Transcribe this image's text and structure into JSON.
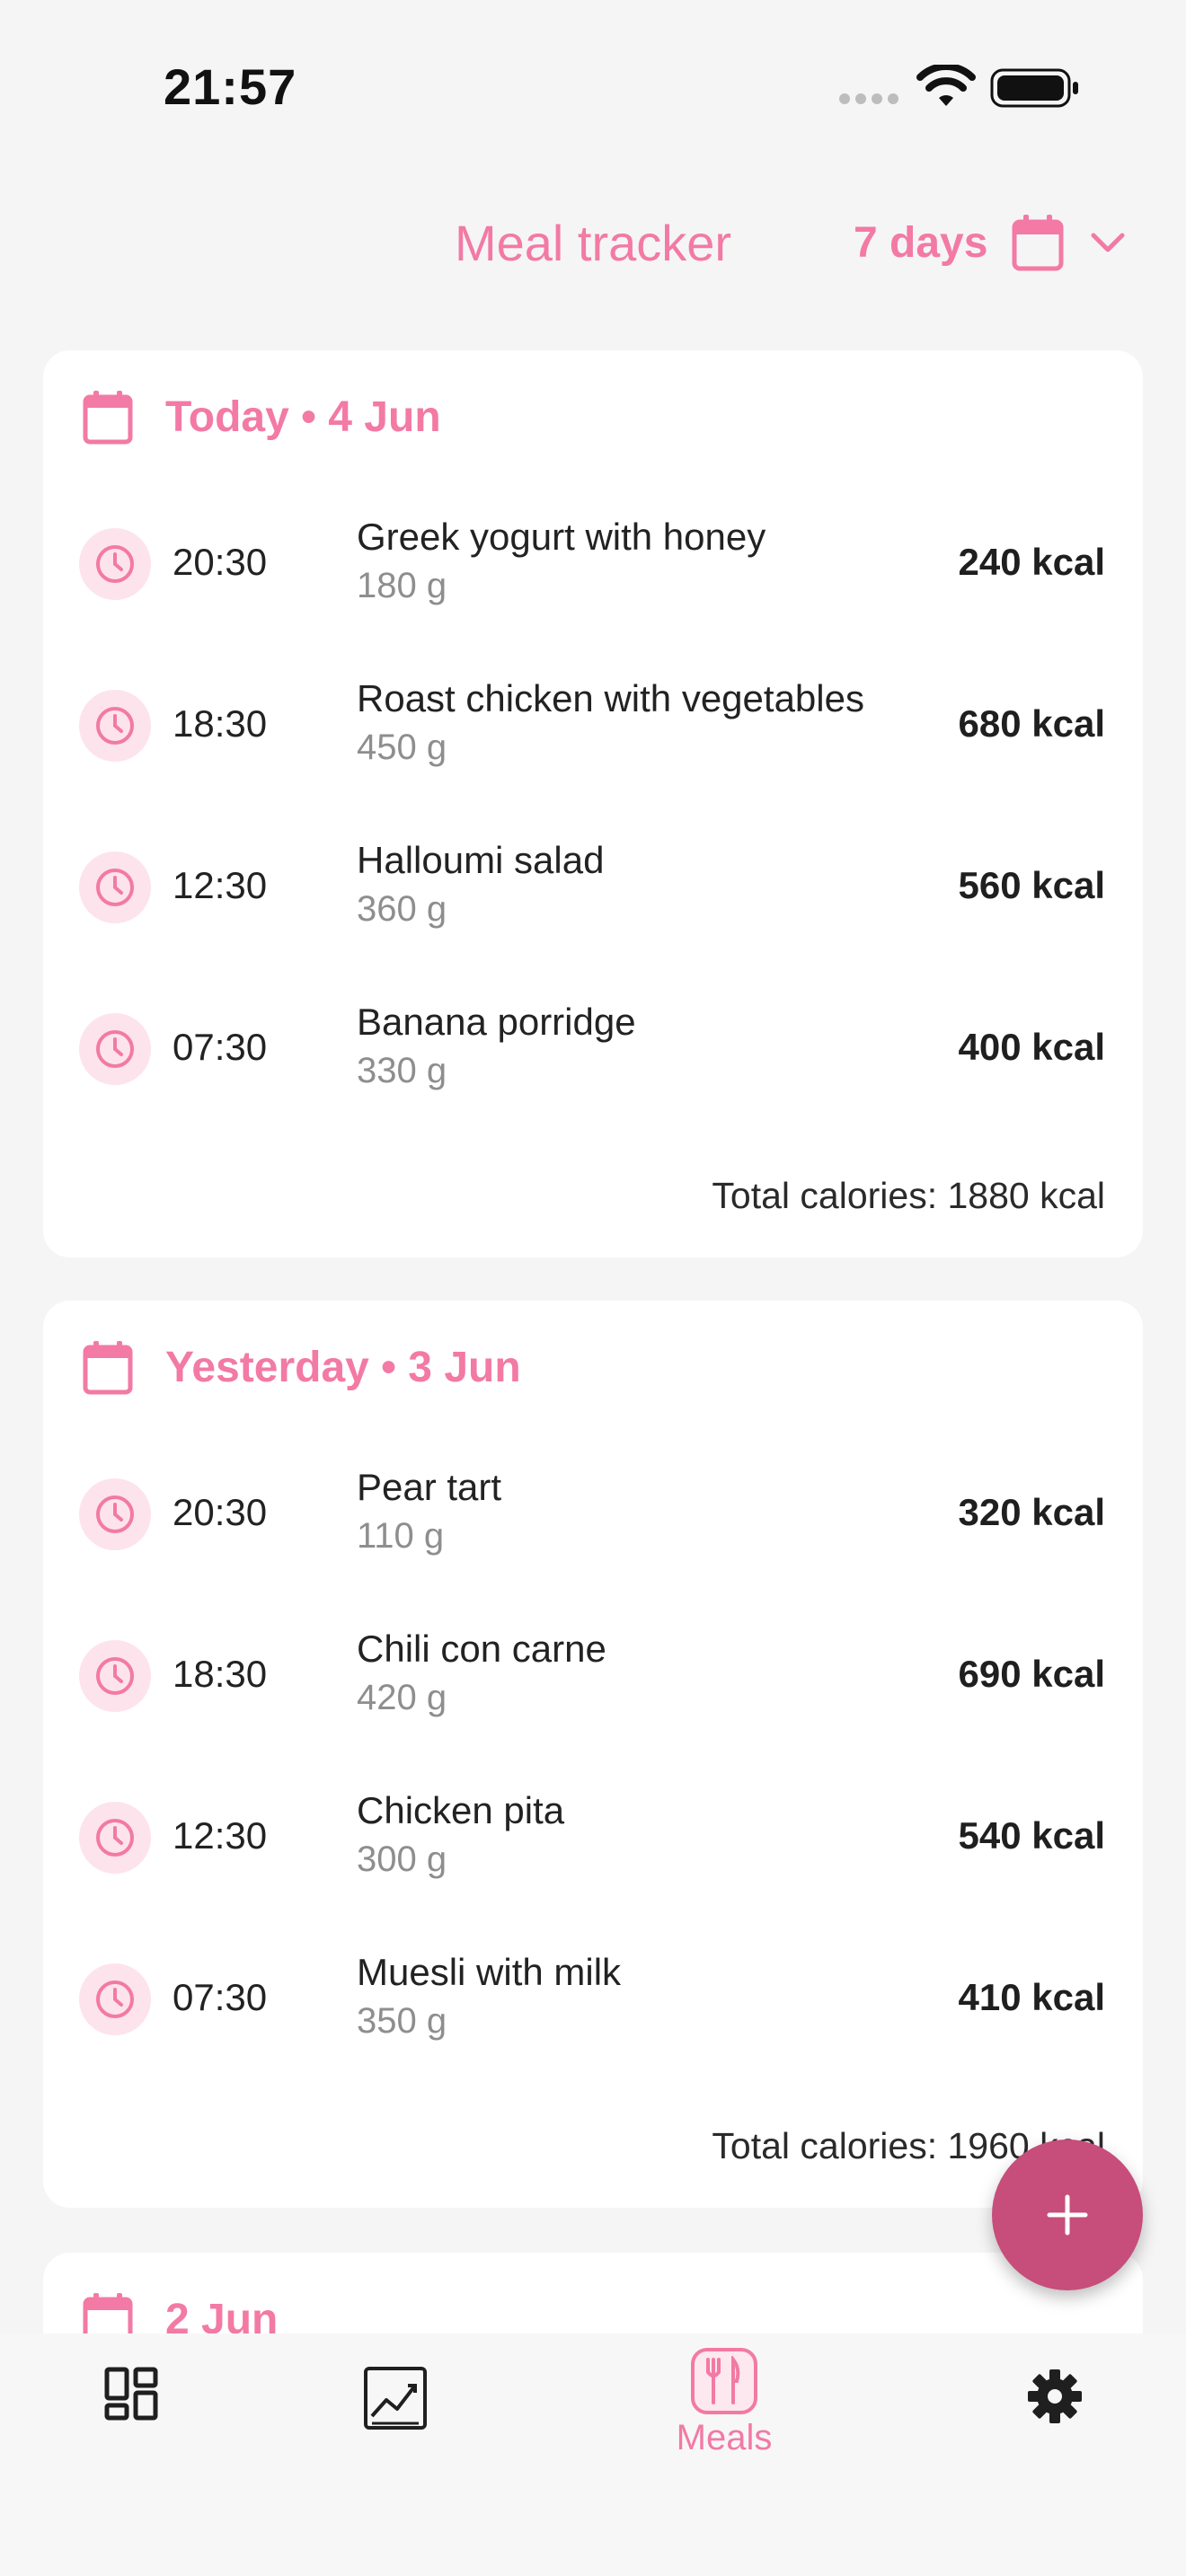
{
  "status_bar": {
    "time": "21:57"
  },
  "header": {
    "title": "Meal tracker",
    "range": "7 days"
  },
  "days": [
    {
      "title": "Today • 4 Jun",
      "meals": [
        {
          "time": "20:30",
          "name": "Greek yogurt with honey",
          "weight": "180 g",
          "kcal": "240 kcal"
        },
        {
          "time": "18:30",
          "name": "Roast chicken with vegetables",
          "weight": "450 g",
          "kcal": "680 kcal"
        },
        {
          "time": "12:30",
          "name": "Halloumi salad",
          "weight": "360 g",
          "kcal": "560 kcal"
        },
        {
          "time": "07:30",
          "name": "Banana porridge",
          "weight": "330 g",
          "kcal": "400 kcal"
        }
      ],
      "total": "Total calories: 1880 kcal"
    },
    {
      "title": "Yesterday • 3 Jun",
      "meals": [
        {
          "time": "20:30",
          "name": "Pear tart",
          "weight": "110 g",
          "kcal": "320 kcal"
        },
        {
          "time": "18:30",
          "name": "Chili con carne",
          "weight": "420 g",
          "kcal": "690 kcal"
        },
        {
          "time": "12:30",
          "name": "Chicken pita",
          "weight": "300 g",
          "kcal": "540 kcal"
        },
        {
          "time": "07:30",
          "name": "Muesli with milk",
          "weight": "350 g",
          "kcal": "410 kcal"
        }
      ],
      "total": "Total calories: 1960 kcal"
    },
    {
      "title": "2 Jun"
    }
  ],
  "bottom_nav": {
    "items": [
      {
        "icon": "dashboard-icon",
        "label": ""
      },
      {
        "icon": "chart-icon",
        "label": ""
      },
      {
        "icon": "meals-icon",
        "label": "Meals",
        "active": true
      },
      {
        "icon": "gear-icon",
        "label": ""
      }
    ]
  },
  "colors": {
    "accent": "#f27aa4",
    "fab": "#c74d7a",
    "badge_bg": "#fde3ec",
    "background": "#f5f5f6"
  }
}
